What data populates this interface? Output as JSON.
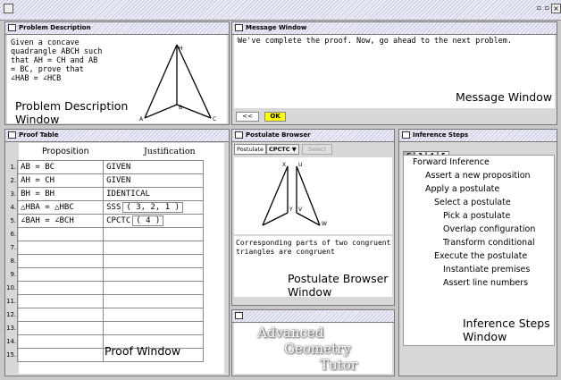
{
  "problem": {
    "title": "Problem Description",
    "text_lines": [
      "Given a concave",
      "quadrangle ABCH such",
      "that AH = CH and AB",
      "= BC, prove that",
      "∠HAB = ∠HCB"
    ],
    "caption_line1": "Problem Description",
    "caption_line2": "Window",
    "point_labels": {
      "h": "H",
      "b": "B",
      "a": "A",
      "c": "C"
    }
  },
  "message": {
    "title": "Message Window",
    "text": "We've complete the proof.  Now, go ahead to the next problem.",
    "caption": "Message Window",
    "back_button": "<<",
    "ok_button": "OK"
  },
  "proof": {
    "title": "Proof Table",
    "col_proposition": "Proposition",
    "col_justification": "Justification",
    "caption": "Proof Window",
    "rows": [
      {
        "num": "1.",
        "prop": "AB = BC",
        "just": "GIVEN",
        "extra": ""
      },
      {
        "num": "2.",
        "prop": "AH = CH",
        "just": "GIVEN",
        "extra": ""
      },
      {
        "num": "3.",
        "prop": "BH = BH",
        "just": "IDENTICAL",
        "extra": ""
      },
      {
        "num": "4.",
        "prop": "△HBA = △HBC",
        "just": "SSS",
        "extra": "( 3, 2, 1 )"
      },
      {
        "num": "5.",
        "prop": "∠BAH = ∠BCH",
        "just": "CPCTC",
        "extra": "( 4 )"
      },
      {
        "num": "6.",
        "prop": "",
        "just": "",
        "extra": ""
      },
      {
        "num": "7.",
        "prop": "",
        "just": "",
        "extra": ""
      },
      {
        "num": "8.",
        "prop": "",
        "just": "",
        "extra": ""
      },
      {
        "num": "9.",
        "prop": "",
        "just": "",
        "extra": ""
      },
      {
        "num": "10.",
        "prop": "",
        "just": "",
        "extra": ""
      },
      {
        "num": "11.",
        "prop": "",
        "just": "",
        "extra": ""
      },
      {
        "num": "12.",
        "prop": "",
        "just": "",
        "extra": ""
      },
      {
        "num": "13.",
        "prop": "",
        "just": "",
        "extra": ""
      },
      {
        "num": "14.",
        "prop": "",
        "just": "",
        "extra": ""
      },
      {
        "num": "15.",
        "prop": "",
        "just": "",
        "extra": ""
      }
    ]
  },
  "postulate": {
    "title": "Postulate Browser",
    "label": "Postulate",
    "selected": "CPCTC",
    "select_button": "Select",
    "description": "Corresponding parts of two congruent triangles are congruent",
    "caption_line1": "Postulate Browser",
    "caption_line2": "Window",
    "point_labels": {
      "x": "X",
      "u": "U",
      "y": "Y",
      "v": "V",
      "w": "W"
    }
  },
  "logo": {
    "line1": "Advanced",
    "line2": "Geometry",
    "line3": "Tutor"
  },
  "inference": {
    "title": "Inference Steps",
    "tabs": [
      "C",
      "3",
      "4",
      "5"
    ],
    "items": [
      "Forward Inference",
      "Assert a new proposition",
      "Apply a postulate",
      "Select a postulate",
      "Pick a postulate",
      "Overlap configuration",
      "Transform conditional",
      "Execute the postulate",
      "Instantiate premises",
      "Assert line numbers"
    ],
    "caption_line1": "Inference Steps",
    "caption_line2": "Window"
  },
  "colors": {
    "title_stripe": "#c6c8e0",
    "ok_button": "#ffff00",
    "background": "#c8c8c8"
  }
}
